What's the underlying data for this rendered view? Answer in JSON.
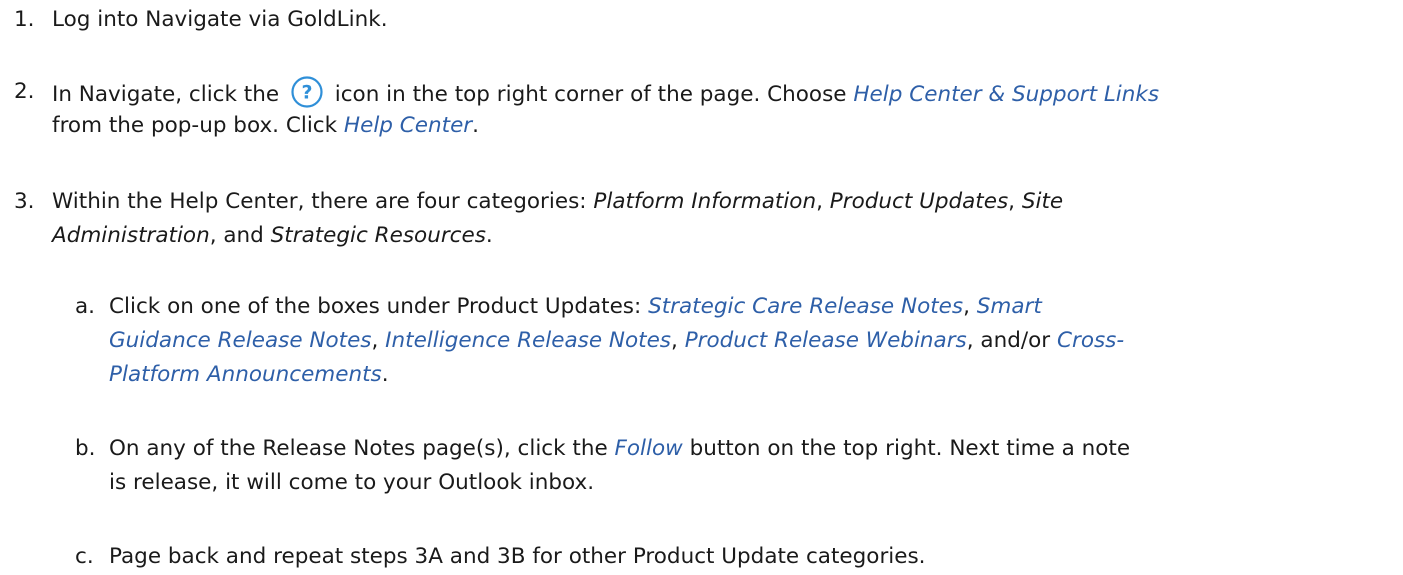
{
  "steps": [
    {
      "num": "1.",
      "line1": "Log into Navigate via GoldLink."
    },
    {
      "num": "2.",
      "pre_icon": "In Navigate, click the",
      "icon": "help-icon",
      "post_icon": "icon in the top right corner of the page.  Choose",
      "link1": "Help Center & Support Links",
      "line2_pre": "from the pop-up box.  Click",
      "link2": "Help Center",
      "line2_post": "."
    },
    {
      "num": "3.",
      "line1_pre": "Within the Help Center, there are four categories:  ",
      "cat1": "Platform Information",
      "sep1": ", ",
      "cat2": "Product Updates",
      "sep2": ", ",
      "cat3a": "Site",
      "cat3b": "Administration",
      "sep3": ", and ",
      "cat4": "Strategic Resources",
      "end": "."
    }
  ],
  "substeps": [
    {
      "letter": "a.",
      "pre": "Click on one of the boxes under Product Updates:  ",
      "l1": "Strategic Care Release Notes",
      "s1": ", ",
      "l2a": "Smart",
      "l2b": "Guidance Release Notes",
      "s2": ", ",
      "l3": "Intelligence Release Notes",
      "s3": ", ",
      "l4": "Product Release Webinars",
      "s4": ", and/or ",
      "l5a": "Cross-",
      "l5b": "Platform Announcements",
      "end": "."
    },
    {
      "letter": "b.",
      "pre": "On any of the Release Notes page(s), click the ",
      "link": "Follow",
      "post": " button on the top right.  Next time a note",
      "line2": "is release, it will come to your Outlook inbox."
    },
    {
      "letter": "c.",
      "line1": "Page back and repeat steps 3A and 3B for other Product Update categories."
    }
  ],
  "colors": {
    "link": "#2e5fa8",
    "text": "#1a1a1a"
  }
}
